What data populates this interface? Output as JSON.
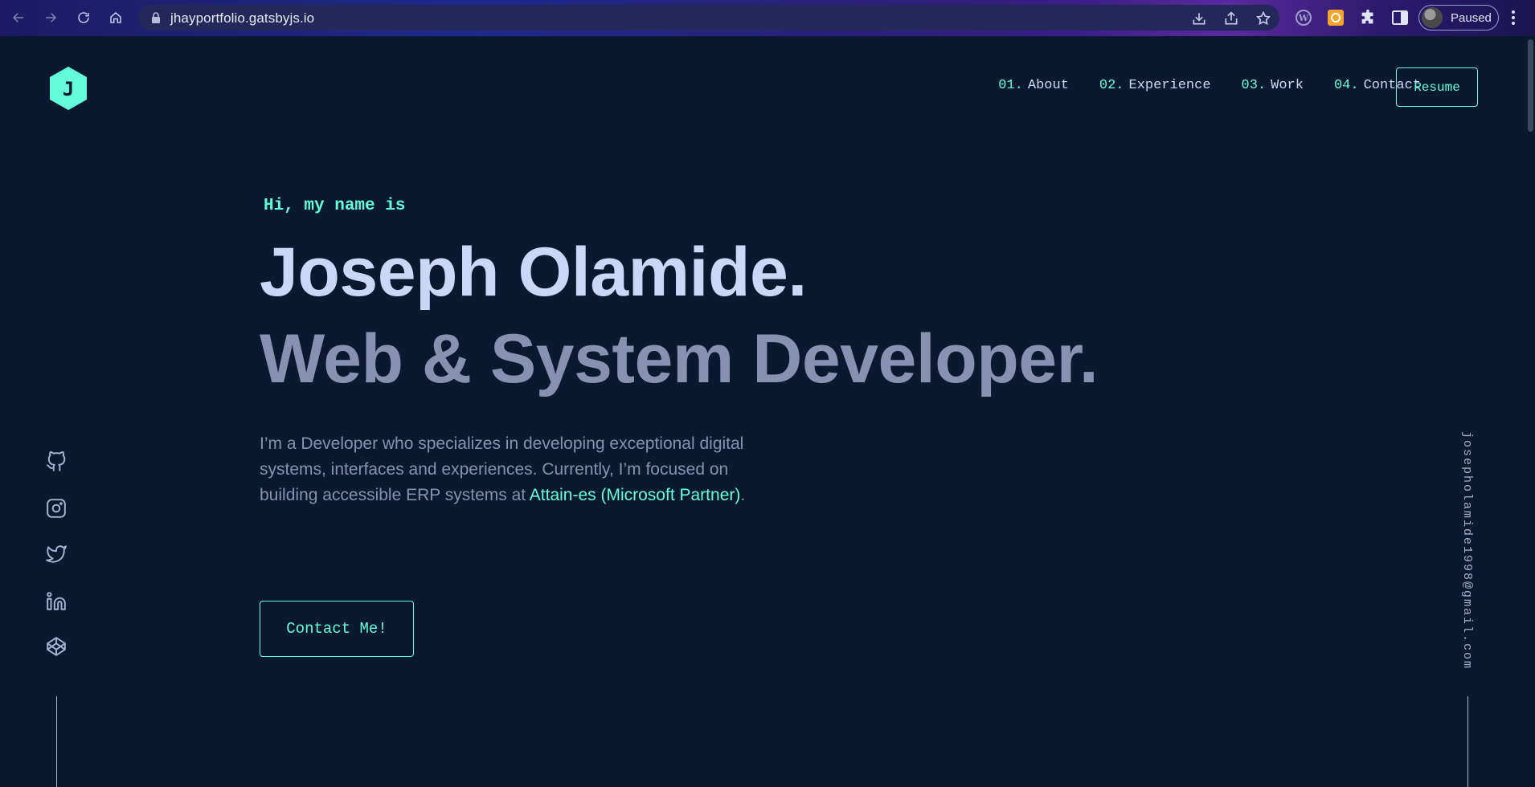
{
  "browser": {
    "url": "jhayportfolio.gatsbyjs.io",
    "profile_status": "Paused"
  },
  "site": {
    "logo_letter": "J",
    "nav": [
      {
        "num": "01.",
        "label": "About"
      },
      {
        "num": "02.",
        "label": "Experience"
      },
      {
        "num": "03.",
        "label": "Work"
      },
      {
        "num": "04.",
        "label": "Contact"
      }
    ],
    "resume_label": "Resume"
  },
  "hero": {
    "greeting": "Hi, my name is",
    "name": "Joseph Olamide.",
    "role": "Web & System Developer.",
    "bio_before": "I’m a Developer who specializes in developing exceptional digital systems, interfaces and experiences. Currently, I’m focused on building accessible ERP systems at ",
    "bio_link": "Attain-es (Microsoft Partner)",
    "bio_after": ".",
    "cta_label": "Contact Me!"
  },
  "sidebar": {
    "socials": [
      "github-icon",
      "instagram-icon",
      "twitter-icon",
      "linkedin-icon",
      "codepen-icon"
    ],
    "email": "josepholamide1998@gmail.com"
  },
  "colors": {
    "background": "#0a192f",
    "accent": "#64ffda",
    "heading": "#ccd6f6",
    "muted": "#8892b0"
  }
}
